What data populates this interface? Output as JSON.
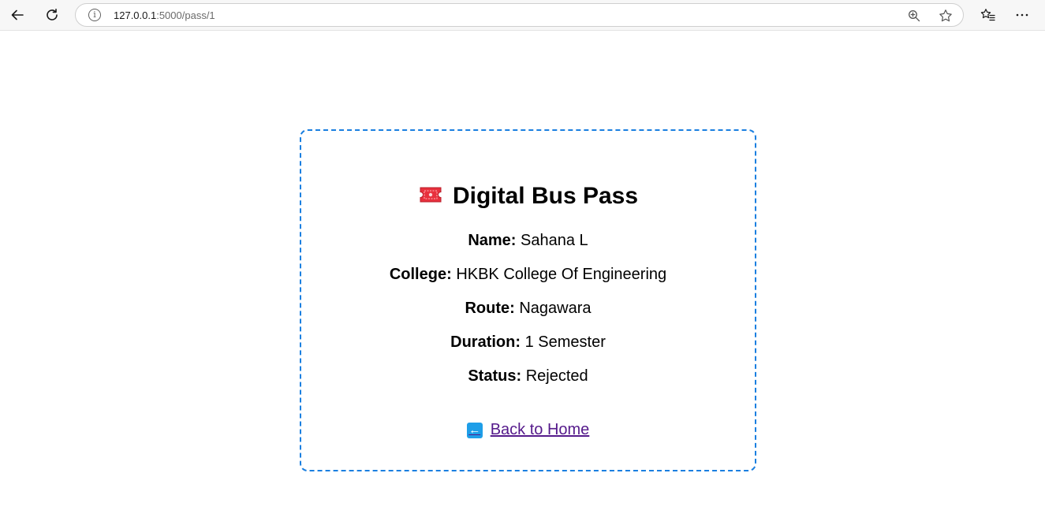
{
  "browser": {
    "url_host": "127.0.0.1",
    "url_path": ":5000/pass/1",
    "info_icon": "info-icon",
    "back_icon": "back-arrow-icon",
    "reload_icon": "reload-icon",
    "zoom_icon": "zoom-icon",
    "star_icon": "star-icon",
    "favorites_icon": "favorites-icon",
    "menu_icon": "more-icon"
  },
  "pass": {
    "title": "Digital Bus Pass",
    "title_icon": "ticket-icon",
    "fields": [
      {
        "label": "Name:",
        "value": "Sahana L"
      },
      {
        "label": "College:",
        "value": "HKBK College Of Engineering"
      },
      {
        "label": "Route:",
        "value": "Nagawara"
      },
      {
        "label": "Duration:",
        "value": "1 Semester"
      },
      {
        "label": "Status:",
        "value": "Rejected"
      }
    ],
    "back_link": "Back to Home",
    "back_link_icon": "left-arrow-icon"
  },
  "colors": {
    "card_border": "#1a7fe0",
    "link": "#551a8b",
    "ticket": "#e8303d"
  }
}
